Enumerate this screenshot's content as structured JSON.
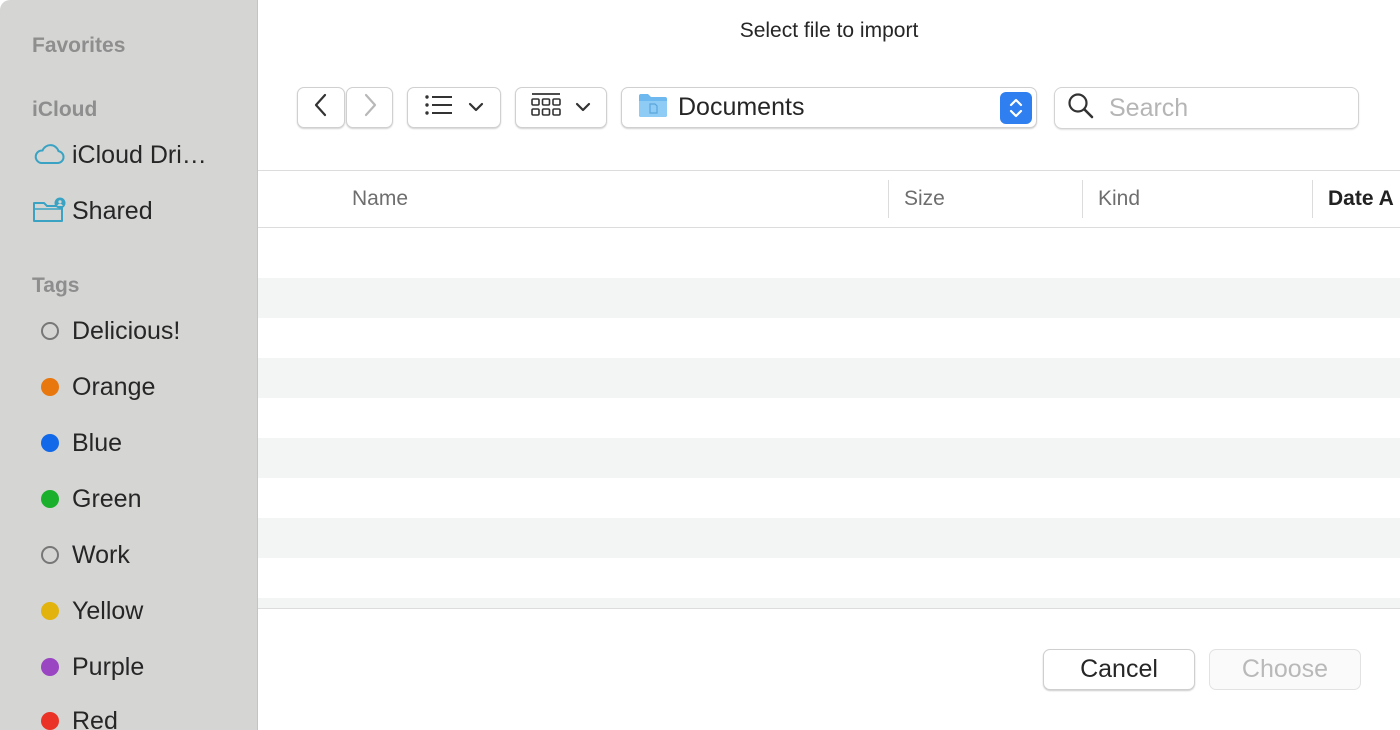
{
  "window": {
    "title": "Select file to import"
  },
  "sidebar": {
    "favorites_label": "Favorites",
    "icloud_label": "iCloud",
    "icloud_items": [
      {
        "label": "iCloud Dri…",
        "icon": "cloud-icon"
      },
      {
        "label": "Shared",
        "icon": "shared-folder-icon"
      }
    ],
    "tags_label": "Tags",
    "tags": [
      {
        "label": "Delicious!",
        "color": "none"
      },
      {
        "label": "Orange",
        "color": "#e8770e"
      },
      {
        "label": "Blue",
        "color": "#1168e8"
      },
      {
        "label": "Green",
        "color": "#1ab02c"
      },
      {
        "label": "Work",
        "color": "none"
      },
      {
        "label": "Yellow",
        "color": "#e2b30c"
      },
      {
        "label": "Purple",
        "color": "#9a45c2"
      },
      {
        "label": "Red",
        "color": "#ea3326"
      }
    ]
  },
  "toolbar": {
    "back_icon": "chevron-left-icon",
    "forward_icon": "chevron-right-icon",
    "view_mode_icon": "list-view-icon",
    "group_icon": "grid-view-icon",
    "location": "Documents",
    "location_icon": "folder-icon",
    "search_placeholder": "Search",
    "search_value": ""
  },
  "table": {
    "columns": [
      "Name",
      "Size",
      "Kind",
      "Date A"
    ],
    "rows": []
  },
  "footer": {
    "cancel_label": "Cancel",
    "choose_label": "Choose"
  },
  "colors": {
    "accent": "#2f7ff0",
    "sidebar_bg": "#d5d6d4",
    "row_alt": "#f3f4f4"
  }
}
